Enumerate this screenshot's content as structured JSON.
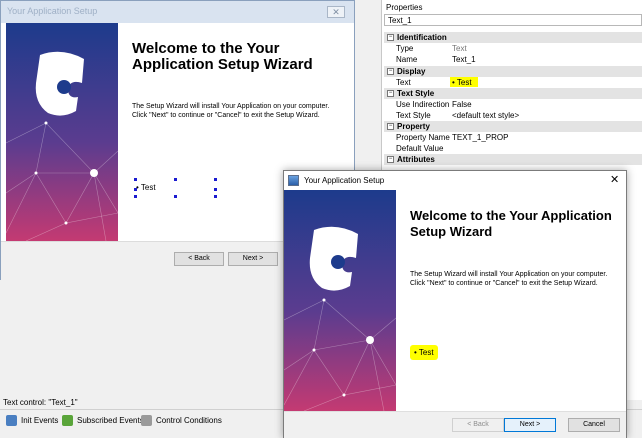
{
  "background_window": {
    "title": "Your Application Setup",
    "close_label": "✕",
    "heading": "Welcome to the Your Application Setup Wizard",
    "description": "The Setup Wizard will install Your Application on your computer.  Click \"Next\" to continue or \"Cancel\" to exit the Setup Wizard.",
    "test_text": "• Test",
    "back_label": "< Back",
    "next_label": "Next >"
  },
  "properties": {
    "title": "Properties",
    "object": "Text_1",
    "categories": [
      {
        "name": "Identification",
        "rows": [
          {
            "name": "Type",
            "value": "Text"
          },
          {
            "name": "Name",
            "value": "Text_1"
          }
        ]
      },
      {
        "name": "Display",
        "rows": [
          {
            "name": "Text",
            "value": "• Test"
          }
        ]
      },
      {
        "name": "Text Style",
        "rows": [
          {
            "name": "Use Indirection",
            "value": "False"
          },
          {
            "name": "Text Style",
            "value": "<default text style>"
          }
        ]
      },
      {
        "name": "Property",
        "rows": [
          {
            "name": "Property Name",
            "value": "TEXT_1_PROP"
          },
          {
            "name": "Default Value",
            "value": ""
          }
        ]
      },
      {
        "name": "Attributes",
        "rows": []
      }
    ],
    "expander": "−"
  },
  "status": {
    "text": "Text control: \"Text_1\"",
    "tabs": [
      "Init Events",
      "Subscribed Events",
      "Control Conditions"
    ]
  },
  "dialog": {
    "title": "Your Application Setup",
    "close_label": "✕",
    "heading": "Welcome to the Your Application Setup Wizard",
    "description": "The Setup Wizard will install Your Application on your computer.  Click \"Next\" to continue or \"Cancel\" to exit the Setup Wizard.",
    "test_text": "• Test",
    "back_label": "< Back",
    "next_label": "Next >",
    "cancel_label": "Cancel"
  },
  "colors": {
    "banner_top": "#1d3f8f",
    "banner_bottom": "#c23a74",
    "highlight": "#ffff00",
    "accent": "#0078d7"
  }
}
